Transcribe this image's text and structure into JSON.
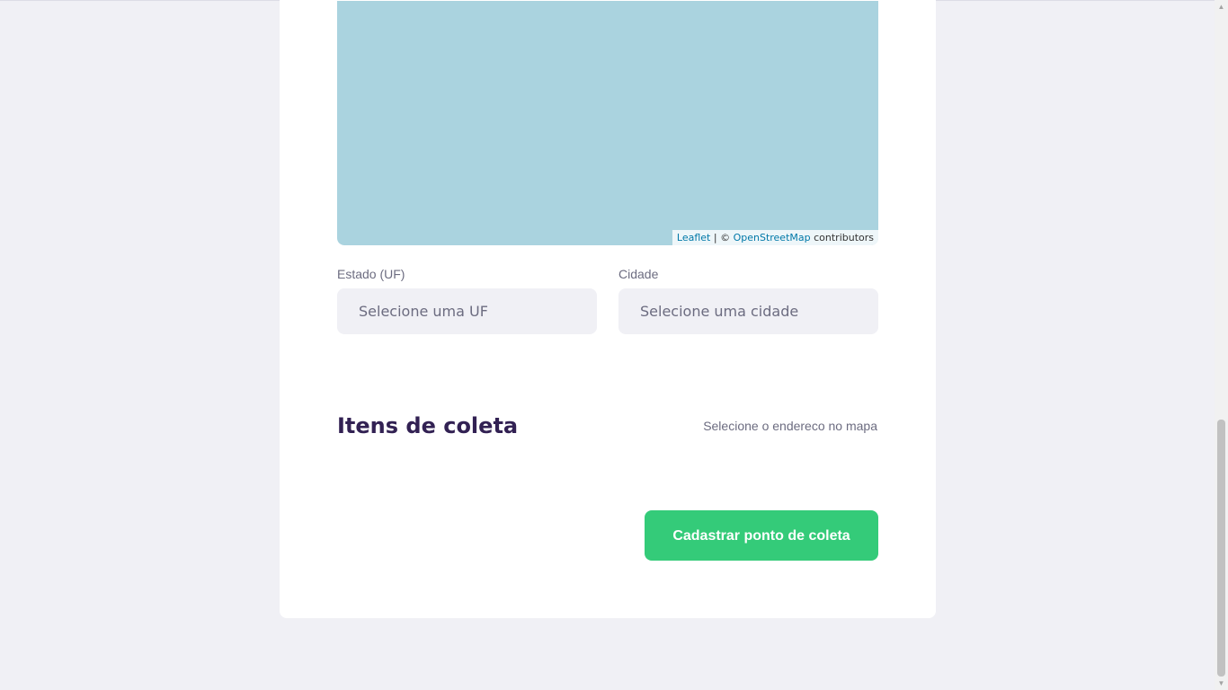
{
  "map": {
    "attribution_leaflet": "Leaflet",
    "attribution_separator": " | © ",
    "attribution_osm": "OpenStreetMap",
    "attribution_contributors": " contributors",
    "water_color": "#aad3df"
  },
  "address": {
    "state_label": "Estado (UF)",
    "state_value": "Selecione uma UF",
    "city_label": "Cidade",
    "city_value": "Selecione uma cidade"
  },
  "items_section": {
    "title": "Itens de coleta",
    "hint": "Selecione o endereco no mapa"
  },
  "submit": {
    "label": "Cadastrar ponto de coleta",
    "color": "#34cb79"
  },
  "icons": {
    "scroll_up": "▲",
    "scroll_down": "▼"
  }
}
